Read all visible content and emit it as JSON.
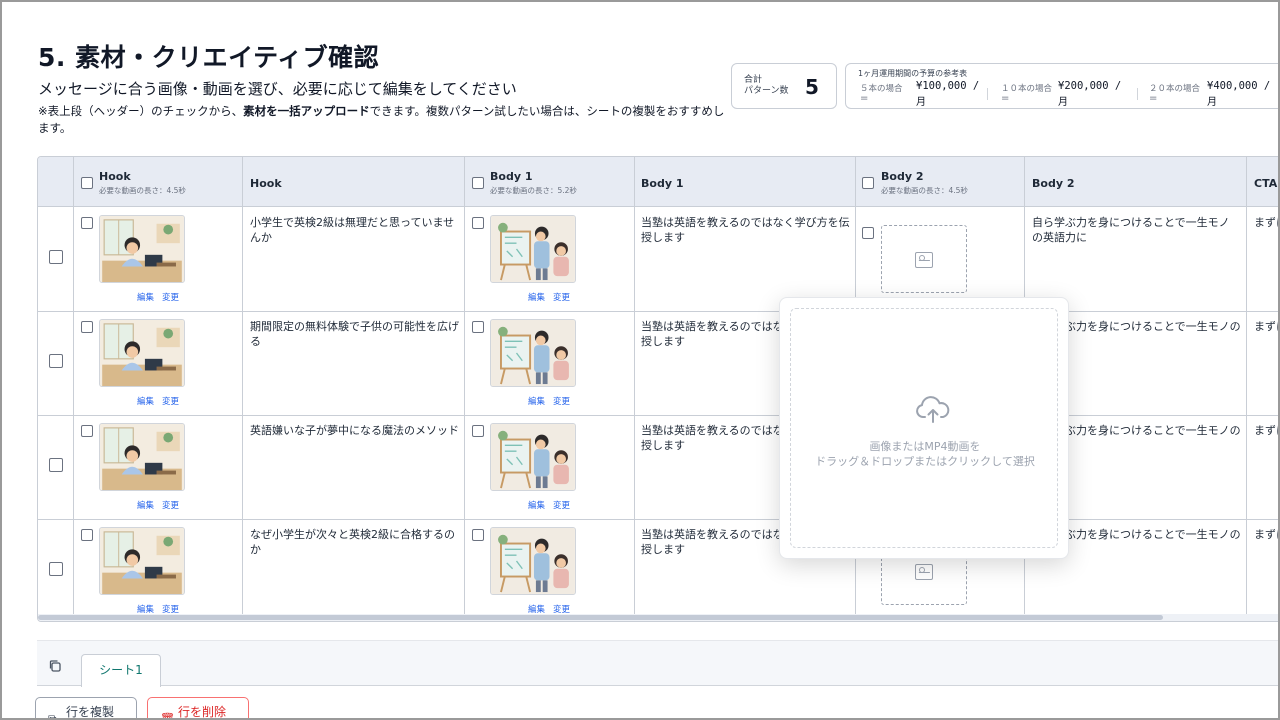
{
  "header": {
    "title": "5. 素材・クリエイティブ確認",
    "subtitle": "メッセージに合う画像・動画を選び、必要に応じて編集をしてください",
    "note_prefix": "※表上段（ヘッダー）のチェックから、",
    "note_bold": "素材を一括アップロード",
    "note_suffix": "できます。複数パターン試したい場合は、シートの複製をおすすめします。"
  },
  "summary": {
    "label": "合計\nパターン数",
    "value": "5"
  },
  "budget": {
    "title": "1ヶ月運用期間の予算の参考表",
    "items": [
      {
        "case": "５本の場合",
        "amount": "¥100,000 /",
        "unit": "月",
        "eq": "="
      },
      {
        "case": "１０本の場合",
        "amount": "¥200,000 /",
        "unit": "月",
        "eq": "="
      },
      {
        "case": "２０本の場合",
        "amount": "¥400,000 /",
        "unit": "月",
        "eq": "="
      }
    ]
  },
  "table": {
    "columns": {
      "hook_media": {
        "name": "Hook",
        "sub": "必要な動画の長さ：4.5秒"
      },
      "hook_text": {
        "name": "Hook"
      },
      "body1_media": {
        "name": "Body 1",
        "sub": "必要な動画の長さ：5.2秒"
      },
      "body1_text": {
        "name": "Body 1"
      },
      "body2_media": {
        "name": "Body 2",
        "sub": "必要な動画の長さ：4.5秒"
      },
      "body2_text": {
        "name": "Body 2"
      },
      "cta": {
        "name": "CTA"
      }
    },
    "media_actions": {
      "edit": "編集",
      "change": "変更"
    },
    "rows": [
      {
        "hook": "小学生で英検2級は無理だと思っていませんか",
        "body1": "当塾は英語を教えるのではなく学び方を伝授します",
        "body2": "自ら学ぶ力を身につけることで一生モノの英語力に",
        "cta": "まずに"
      },
      {
        "hook": "期間限定の無料体験で子供の可能性を広げる",
        "body1": "当塾は英語を教えるのではなく学び方を伝授します",
        "body2": "自ら学ぶ力を身につけることで一生モノの英",
        "cta": "まずに"
      },
      {
        "hook": "英語嫌いな子が夢中になる魔法のメソッド",
        "body1": "当塾は英語を教えるのではなく学び方を伝授します",
        "body2": "自ら学ぶ力を身につけることで一生モノの英",
        "cta": "まずに"
      },
      {
        "hook": "なぜ小学生が次々と英検2級に合格するのか",
        "body1": "当塾は英語を教えるのではなく学び方を伝授します",
        "body2": "自ら学ぶ力を身につけることで一生モノの英",
        "cta": "まずに"
      }
    ]
  },
  "upload": {
    "text": "画像またはMP4動画を\nドラッグ＆ドロップまたはクリックして選択"
  },
  "footer": {
    "sheet_tab": "シート1",
    "copy_row": "行を複製",
    "delete_row": "行を削除"
  }
}
